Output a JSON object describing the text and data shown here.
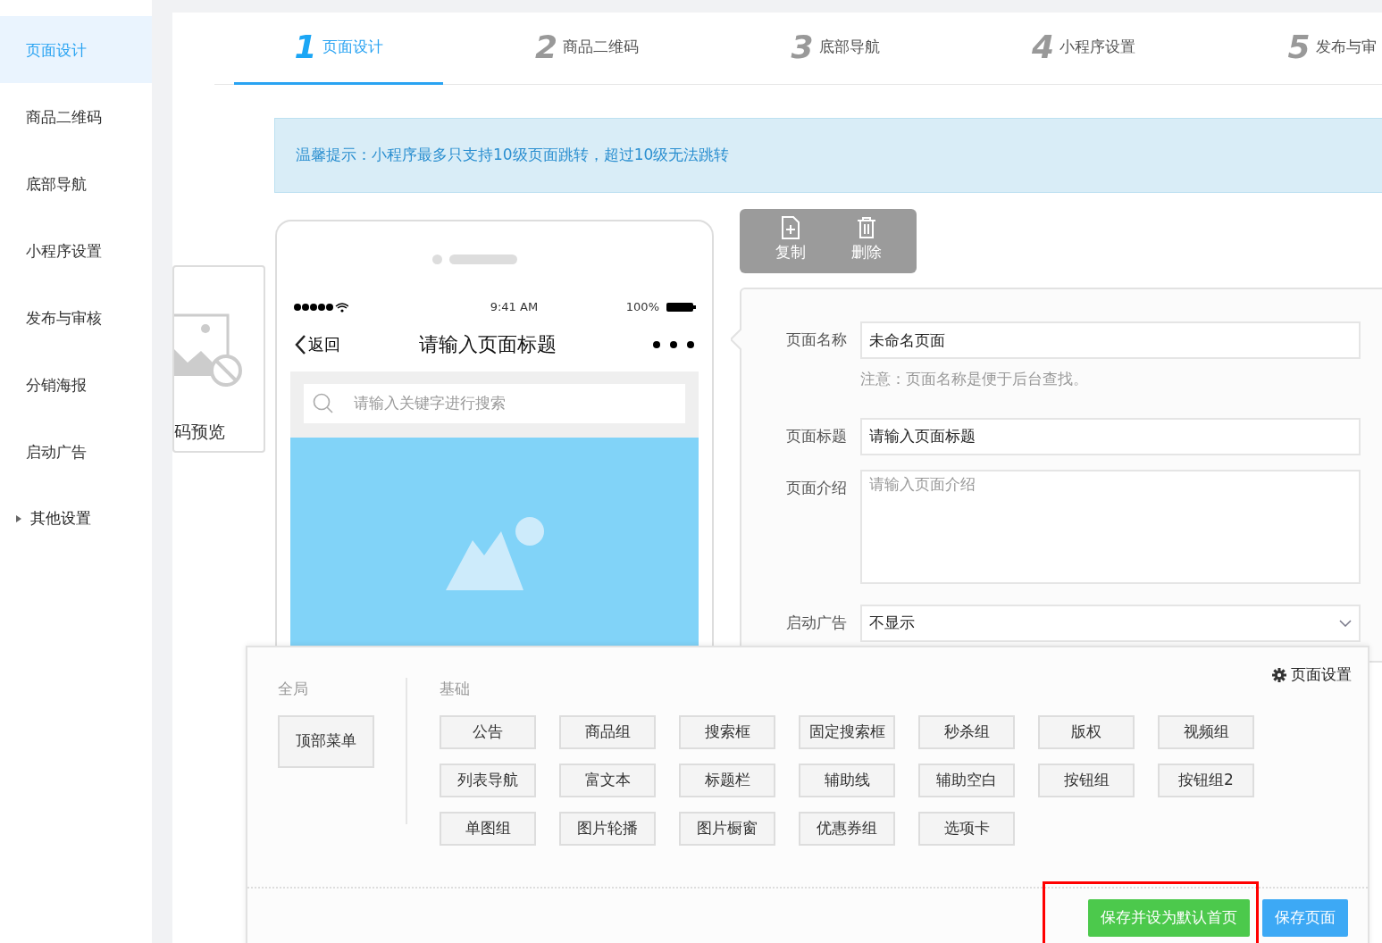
{
  "sidebar": {
    "items": [
      {
        "label": "页面设计",
        "selected": true,
        "kind": "item"
      },
      {
        "label": "商品二维码",
        "selected": false,
        "kind": "item"
      },
      {
        "label": "底部导航",
        "selected": false,
        "kind": "item"
      },
      {
        "label": "小程序设置",
        "selected": false,
        "kind": "item"
      },
      {
        "label": "发布与审核",
        "selected": false,
        "kind": "item"
      },
      {
        "label": "分销海报",
        "selected": false,
        "kind": "item"
      },
      {
        "label": "启动广告",
        "selected": false,
        "kind": "item"
      },
      {
        "label": "其他设置",
        "selected": false,
        "kind": "group"
      }
    ]
  },
  "steps": [
    {
      "number": "1",
      "label": "页面设计",
      "selected": true
    },
    {
      "number": "2",
      "label": "商品二维码",
      "selected": false
    },
    {
      "number": "3",
      "label": "底部导航",
      "selected": false
    },
    {
      "number": "4",
      "label": "小程序设置",
      "selected": false
    },
    {
      "number": "5",
      "label": "发布与审",
      "selected": false
    }
  ],
  "notice": "温馨提示：小程序最多只支持10级页面跳转，超过10级无法跳转",
  "preview_card": {
    "label": "码预览"
  },
  "phone": {
    "time": "9:41 AM",
    "battery": "100%",
    "back": "返回",
    "title": "请输入页面标题",
    "search_placeholder": "请输入关键字进行搜索"
  },
  "toolbar": [
    {
      "label": "复制",
      "kind": "copy"
    },
    {
      "label": "删除",
      "kind": "delete"
    }
  ],
  "form": {
    "fields": [
      {
        "label": "页面名称",
        "kind": "text",
        "value": "未命名页面",
        "hint": "注意：页面名称是便于后台查找。"
      },
      {
        "label": "页面标题",
        "kind": "text",
        "value": "请输入页面标题"
      },
      {
        "label": "页面介绍",
        "kind": "textarea",
        "placeholder": "请输入页面介绍"
      },
      {
        "label": "启动广告",
        "kind": "select",
        "value": "不显示"
      }
    ]
  },
  "components": {
    "settings_link": "页面设置",
    "groups": [
      {
        "title": "全局",
        "items": [
          "顶部菜单"
        ]
      },
      {
        "title": "基础",
        "items": [
          "公告",
          "商品组",
          "搜索框",
          "固定搜索框",
          "秒杀组",
          "版权",
          "视频组",
          "列表导航",
          "富文本",
          "标题栏",
          "辅助线",
          "辅助空白",
          "按钮组",
          "按钮组2",
          "单图组",
          "图片轮播",
          "图片橱窗",
          "优惠券组",
          "选项卡"
        ]
      }
    ]
  },
  "actions": [
    {
      "label": "保存并设为默认首页",
      "kind": "success",
      "highlighted": true
    },
    {
      "label": "保存页面",
      "kind": "primary",
      "highlighted": false
    }
  ]
}
